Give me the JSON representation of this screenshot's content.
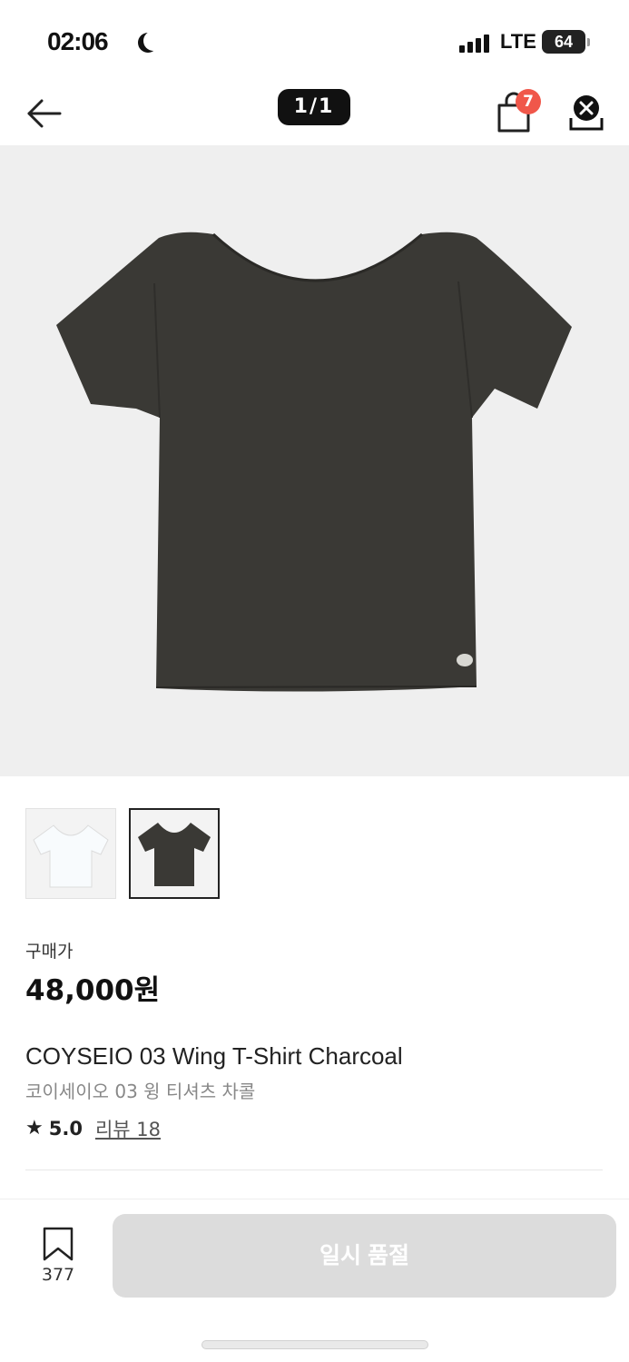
{
  "status_bar": {
    "time": "02:06",
    "network": "LTE",
    "battery": "64"
  },
  "nav": {
    "page_indicator": "1/1",
    "cart_count": "7"
  },
  "product": {
    "price_label": "구매가",
    "price": "48,000원",
    "title": "COYSEIO 03 Wing T-Shirt Charcoal",
    "subtitle": "코이세이오 03 윙 티셔츠 차콜",
    "rating": "5.0",
    "review_label": "리뷰 18",
    "colors": {
      "charcoal": "#3a3935",
      "white": "#ffffff"
    }
  },
  "bottom": {
    "bookmark_count": "377",
    "soldout_label": "일시 품절"
  }
}
